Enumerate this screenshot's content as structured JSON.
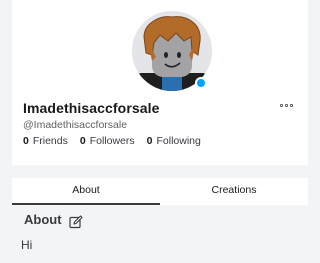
{
  "profile": {
    "display_name": "Imadethisaccforsale",
    "username": "@Imadethisaccforsale",
    "avatar_icon": "avatar-icon",
    "presence": "online",
    "presence_color": "#00a2ff",
    "stats": [
      {
        "count": "0",
        "label": "Friends"
      },
      {
        "count": "0",
        "label": "Followers"
      },
      {
        "count": "0",
        "label": "Following"
      }
    ],
    "more_icon": "more-options-icon"
  },
  "tabs": [
    {
      "label": "About",
      "active": true
    },
    {
      "label": "Creations",
      "active": false
    }
  ],
  "about": {
    "title": "About",
    "edit_icon": "edit-icon",
    "text": "Hi"
  }
}
